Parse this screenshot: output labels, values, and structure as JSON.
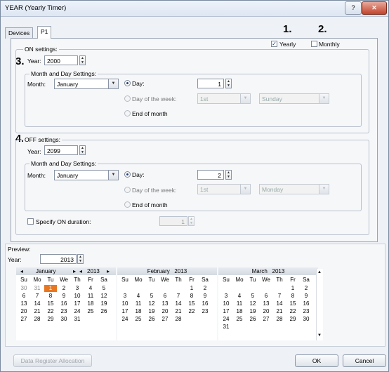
{
  "window": {
    "title": "YEAR (Yearly Timer)",
    "help_glyph": "?",
    "close_glyph": "✕"
  },
  "tabs": [
    {
      "label": "Devices"
    },
    {
      "label": "P1"
    }
  ],
  "markers": {
    "m1": "1.",
    "m2": "2.",
    "m3": "3.",
    "m4": "4."
  },
  "mode": {
    "yearly_label": "Yearly",
    "monthly_label": "Monthly",
    "yearly_checked": true,
    "monthly_checked": false
  },
  "on": {
    "group_label": "ON settings:",
    "year_label": "Year:",
    "year_value": "2000",
    "mds_label": "Month and Day Settings:",
    "month_label": "Month:",
    "month_value": "January",
    "day_label": "Day:",
    "day_value": "1",
    "dow_label": "Day of the week:",
    "dow_week": "1st",
    "dow_day": "Sunday",
    "eom_label": "End of month"
  },
  "off": {
    "group_label": "OFF settings:",
    "year_label": "Year:",
    "year_value": "2099",
    "mds_label": "Month and Day Settings:",
    "month_label": "Month:",
    "month_value": "January",
    "day_label": "Day:",
    "day_value": "2",
    "dow_label": "Day of the week:",
    "dow_week": "1st",
    "dow_day": "Monday",
    "eom_label": "End of month",
    "duration_label": "Specify ON duration:",
    "duration_value": "1"
  },
  "preview": {
    "label": "Preview:",
    "year_label": "Year:",
    "year_value": "2013",
    "weekdays": [
      "Su",
      "Mo",
      "Tu",
      "We",
      "Th",
      "Fr",
      "Sa"
    ],
    "nav": {
      "prev": "◂",
      "next": "▸"
    },
    "months": [
      {
        "name": "January",
        "year": "2013",
        "rows": [
          [
            "30",
            "31",
            "1",
            "2",
            "3",
            "4",
            "5"
          ],
          [
            "6",
            "7",
            "8",
            "9",
            "10",
            "11",
            "12"
          ],
          [
            "13",
            "14",
            "15",
            "16",
            "17",
            "18",
            "19"
          ],
          [
            "20",
            "21",
            "22",
            "23",
            "24",
            "25",
            "26"
          ],
          [
            "27",
            "28",
            "29",
            "30",
            "31",
            "",
            ""
          ]
        ],
        "highlight": "1"
      },
      {
        "name": "February",
        "year": "2013",
        "rows": [
          [
            "",
            "",
            "",
            "",
            "",
            "1",
            "2"
          ],
          [
            "3",
            "4",
            "5",
            "6",
            "7",
            "8",
            "9"
          ],
          [
            "10",
            "11",
            "12",
            "13",
            "14",
            "15",
            "16"
          ],
          [
            "17",
            "18",
            "19",
            "20",
            "21",
            "22",
            "23"
          ],
          [
            "24",
            "25",
            "26",
            "27",
            "28",
            "",
            ""
          ]
        ]
      },
      {
        "name": "March",
        "year": "2013",
        "rows": [
          [
            "",
            "",
            "",
            "",
            "",
            "1",
            "2"
          ],
          [
            "3",
            "4",
            "5",
            "6",
            "7",
            "8",
            "9"
          ],
          [
            "10",
            "11",
            "12",
            "13",
            "14",
            "15",
            "16"
          ],
          [
            "17",
            "18",
            "19",
            "20",
            "21",
            "22",
            "23"
          ],
          [
            "24",
            "25",
            "26",
            "27",
            "28",
            "29",
            "30"
          ],
          [
            "31",
            "",
            "",
            "",
            "",
            "",
            ""
          ]
        ]
      }
    ]
  },
  "footer": {
    "dra_label": "Data Register Allocation",
    "ok_label": "OK",
    "cancel_label": "Cancel"
  }
}
